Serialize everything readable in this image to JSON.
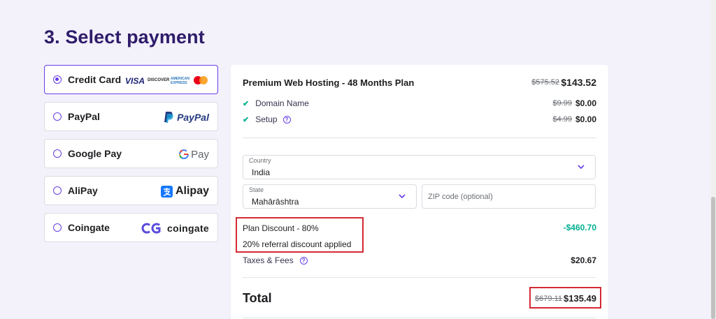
{
  "section": {
    "title": "3. Select payment"
  },
  "payment_methods": [
    {
      "label": "Credit Card",
      "selected": true,
      "logos": [
        "VISA",
        "DISCOVER",
        "AMERICAN EXPRESS",
        "mastercard"
      ]
    },
    {
      "label": "PayPal",
      "selected": false,
      "logo_text": "PayPal"
    },
    {
      "label": "Google Pay",
      "selected": false,
      "logo_text": "Pay"
    },
    {
      "label": "AliPay",
      "selected": false,
      "logo_text": "Alipay"
    },
    {
      "label": "Coingate",
      "selected": false,
      "logo_text": "coingate"
    }
  ],
  "order": {
    "plan_title": "Premium Web Hosting - 48 Months Plan",
    "plan_old_price": "$575.52",
    "plan_new_price": "$143.52",
    "features": [
      {
        "label": "Domain Name",
        "old_price": "$9.99",
        "new_price": "$0.00",
        "help": false
      },
      {
        "label": "Setup",
        "old_price": "$4.99",
        "new_price": "$0.00",
        "help": true
      }
    ],
    "country": {
      "caption": "Country",
      "value": "India"
    },
    "state": {
      "caption": "State",
      "value": "Mahārāshtra"
    },
    "zip": {
      "placeholder": "ZIP code (optional)"
    },
    "discount_label": "Plan Discount - 80%",
    "referral_label": "20% referral discount applied",
    "discount_value": "-$460.70",
    "taxes_label": "Taxes & Fees",
    "taxes_value": "$20.67",
    "total_label": "Total",
    "total_old": "$679.11",
    "total_new": "$135.49"
  },
  "colors": {
    "accent": "#673de6",
    "title": "#2f1c6a",
    "discount": "#00b090",
    "highlight": "#d42a35"
  }
}
